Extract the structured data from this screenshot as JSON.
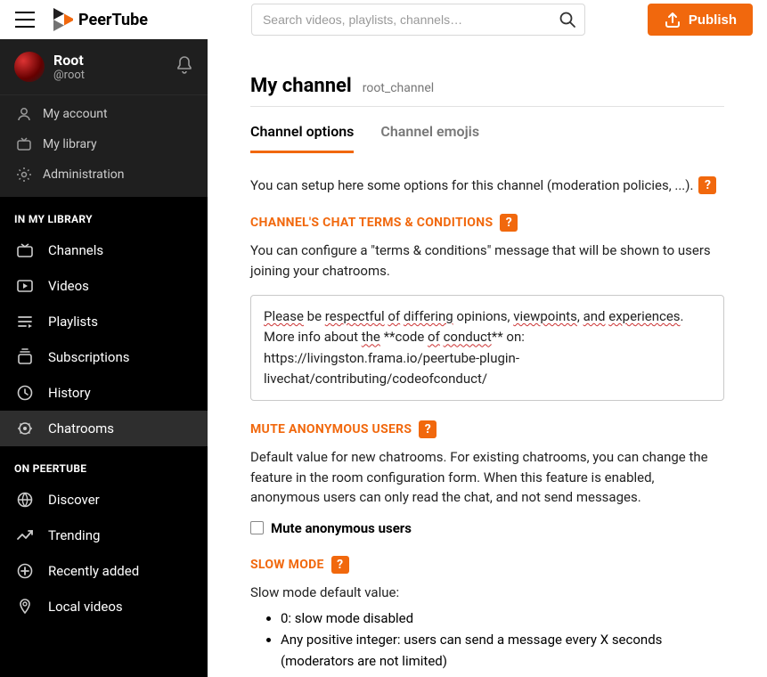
{
  "brand": {
    "name": "PeerTube"
  },
  "search": {
    "placeholder": "Search videos, playlists, channels…"
  },
  "publish": {
    "label": "Publish"
  },
  "user": {
    "display_name": "Root",
    "handle": "@root"
  },
  "account_links": {
    "my_account": "My account",
    "my_library": "My library",
    "administration": "Administration"
  },
  "sections": {
    "in_my_library": "IN MY LIBRARY",
    "on_peertube": "ON PEERTUBE"
  },
  "library_items": {
    "channels": "Channels",
    "videos": "Videos",
    "playlists": "Playlists",
    "subscriptions": "Subscriptions",
    "history": "History",
    "chatrooms": "Chatrooms"
  },
  "peertube_items": {
    "discover": "Discover",
    "trending": "Trending",
    "recently_added": "Recently added",
    "local_videos": "Local videos"
  },
  "page": {
    "title": "My channel",
    "channel_name": "root_channel"
  },
  "tabs": {
    "options": "Channel options",
    "emojis": "Channel emojis"
  },
  "intro": "You can setup here some options for this channel (moderation policies, ...).",
  "terms": {
    "label": "CHANNEL'S CHAT TERMS & CONDITIONS",
    "desc": "You can configure a \"terms & conditions\" message that will be shown to users joining your chatrooms.",
    "value": "Please be respectful of differing opinions, viewpoints, and experiences. More info about the **code of conduct** on: https://livingston.frama.io/peertube-plugin-livechat/contributing/codeofconduct/"
  },
  "mute": {
    "label": "MUTE ANONYMOUS USERS",
    "desc": "Default value for new chatrooms. For existing chatrooms, you can change the feature in the room configuration form. When this feature is enabled, anonymous users can only read the chat, and not send messages.",
    "checkbox_label": "Mute anonymous users"
  },
  "slow": {
    "label": "SLOW MODE",
    "desc": "Slow mode default value:",
    "bullets": [
      "0: slow mode disabled",
      "Any positive integer: users can send a message every X seconds (moderators are not limited)"
    ]
  },
  "help": "?"
}
